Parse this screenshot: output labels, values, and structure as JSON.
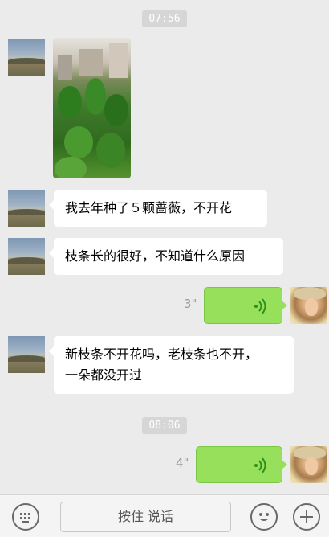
{
  "timestamps": [
    "07:56",
    "08:06"
  ],
  "messages": [
    {
      "side": "left",
      "type": "image",
      "content": ""
    },
    {
      "side": "left",
      "type": "text",
      "text": "我去年种了５颗蔷薇，不开花"
    },
    {
      "side": "left",
      "type": "text",
      "text": "枝条长的很好，不知道什么原因"
    },
    {
      "side": "right",
      "type": "voice",
      "duration": "3\""
    },
    {
      "side": "left",
      "type": "text",
      "lines": [
        "新枝条不开花吗，老枝条也不开，",
        "一朵都没开过"
      ]
    },
    {
      "side": "right",
      "type": "voice",
      "duration": "4\""
    }
  ],
  "input_bar": {
    "keyboard_icon": "keyboard-icon",
    "hold_to_talk_label": "按住 说话",
    "emoji_icon": "smiley-face-icon",
    "more_icon": "plus-icon"
  },
  "colors": {
    "background": "#ebebeb",
    "incoming_bubble": "#ffffff",
    "outgoing_voice_bubble": "#96e05b",
    "timestamp_pill": "#d6d6d6"
  }
}
